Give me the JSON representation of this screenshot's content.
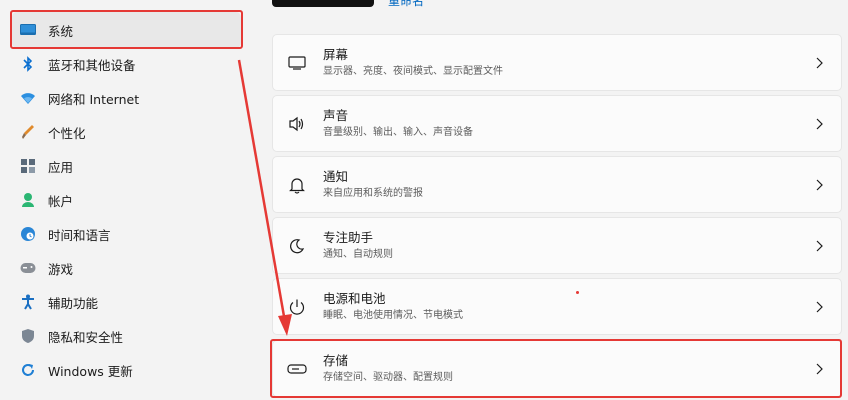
{
  "sidebar": {
    "items": [
      {
        "label": "系统",
        "icon": "display-icon"
      },
      {
        "label": "蓝牙和其他设备",
        "icon": "bluetooth-icon"
      },
      {
        "label": "网络和 Internet",
        "icon": "wifi-icon"
      },
      {
        "label": "个性化",
        "icon": "brush-icon"
      },
      {
        "label": "应用",
        "icon": "apps-icon"
      },
      {
        "label": "帐户",
        "icon": "account-icon"
      },
      {
        "label": "时间和语言",
        "icon": "globe-clock-icon"
      },
      {
        "label": "游戏",
        "icon": "gamepad-icon"
      },
      {
        "label": "辅助功能",
        "icon": "accessibility-icon"
      },
      {
        "label": "隐私和安全性",
        "icon": "shield-icon"
      },
      {
        "label": "Windows 更新",
        "icon": "update-icon"
      }
    ]
  },
  "header": {
    "rename_link": "重命名"
  },
  "cards": [
    {
      "title": "屏幕",
      "subtitle": "显示器、亮度、夜间模式、显示配置文件",
      "icon": "monitor-icon"
    },
    {
      "title": "声音",
      "subtitle": "音量级别、输出、输入、声音设备",
      "icon": "speaker-icon"
    },
    {
      "title": "通知",
      "subtitle": "来自应用和系统的警报",
      "icon": "bell-icon"
    },
    {
      "title": "专注助手",
      "subtitle": "通知、自动规则",
      "icon": "moon-icon"
    },
    {
      "title": "电源和电池",
      "subtitle": "睡眠、电池使用情况、节电模式",
      "icon": "power-icon"
    },
    {
      "title": "存储",
      "subtitle": "存储空间、驱动器、配置规则",
      "icon": "drive-icon"
    }
  ],
  "colors": {
    "accent": "#0067c0",
    "highlight": "#e53935"
  }
}
